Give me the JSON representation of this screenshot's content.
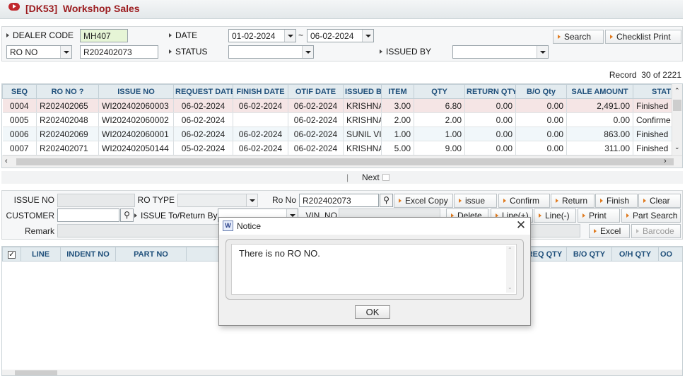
{
  "title": {
    "code": "[DK53]",
    "name": "Workshop Sales"
  },
  "filters": {
    "dealer_code_label": "DEALER CODE",
    "dealer_code_value": "MH407",
    "date_label": "DATE",
    "date_from": "01-02-2024",
    "date_sep": "~",
    "date_to": "06-02-2024",
    "search_type": "RO NO",
    "search_value": "R202402073",
    "status_label": "STATUS",
    "status_value": "",
    "issued_by_label": "ISSUED BY",
    "issued_by_value": "",
    "search_button": "Search",
    "checklist_button": "Checklist Print"
  },
  "record": {
    "label": "Record",
    "current": "30",
    "of": "of",
    "total": "2221"
  },
  "grid1": {
    "columns": [
      "SEQ",
      "RO NO ?",
      "ISSUE NO",
      "REQUEST DATE",
      "FINISH DATE",
      "OTIF DATE",
      "ISSUED BY",
      "ITEM",
      "QTY",
      "RETURN QTY",
      "B/O Qty",
      "SALE AMOUNT",
      "STAT"
    ],
    "rows": [
      {
        "seq": "0004",
        "ro": "R202402065",
        "issue": "WI202402060003",
        "req": "06-02-2024",
        "fin": "06-02-2024",
        "otif": "06-02-2024",
        "by": "KRISHNA",
        "item": "3.00",
        "qty": "6.80",
        "ret": "0.00",
        "bo": "0.00",
        "amt": "2,491.00",
        "stat": "Finished"
      },
      {
        "seq": "0005",
        "ro": "R202402048",
        "issue": "WI202402060002",
        "req": "06-02-2024",
        "fin": "",
        "otif": "06-02-2024",
        "by": "KRISHNA",
        "item": "2.00",
        "qty": "2.00",
        "ret": "0.00",
        "bo": "0.00",
        "amt": "0.00",
        "stat": "Confirme"
      },
      {
        "seq": "0006",
        "ro": "R202402069",
        "issue": "WI202402060001",
        "req": "06-02-2024",
        "fin": "06-02-2024",
        "otif": "06-02-2024",
        "by": "SUNIL VI",
        "item": "1.00",
        "qty": "1.00",
        "ret": "0.00",
        "bo": "0.00",
        "amt": "863.00",
        "stat": "Finished"
      },
      {
        "seq": "0007",
        "ro": "R202402071",
        "issue": "WI202402050144",
        "req": "05-02-2024",
        "fin": "06-02-2024",
        "otif": "06-02-2024",
        "by": "KRISHNA",
        "item": "5.00",
        "qty": "9.00",
        "ret": "0.00",
        "bo": "0.00",
        "amt": "311.00",
        "stat": "Finished"
      }
    ]
  },
  "pager": {
    "sep": "|",
    "next": "Next"
  },
  "detail": {
    "issue_no_label": "ISSUE NO",
    "ro_type_label": "RO TYPE",
    "ro_no_label": "Ro No",
    "ro_no_value": "R202402073",
    "customer_label": "CUSTOMER",
    "issue_to_label": "ISSUE To/Return By",
    "vin_label": "VIN. NO",
    "remark_label": "Remark",
    "buttons": {
      "excel_copy": "Excel Copy",
      "issue": "issue",
      "confirm": "Confirm",
      "return": "Return",
      "finish": "Finish",
      "clear": "Clear",
      "delete": "Delete",
      "line_plus": "Line(+)",
      "line_minus": "Line(-)",
      "print": "Print",
      "part_search": "Part Search",
      "excel": "Excel",
      "barcode": "Barcode"
    }
  },
  "grid2": {
    "columns": [
      "",
      "LINE",
      "INDENT NO",
      "PART NO",
      "",
      "REQ QTY",
      "B/O QTY",
      "O/H QTY",
      "OO"
    ]
  },
  "dialog": {
    "title": "Notice",
    "message": "There is no RO NO.",
    "ok": "OK",
    "close": "✕",
    "icon_text": "W"
  }
}
